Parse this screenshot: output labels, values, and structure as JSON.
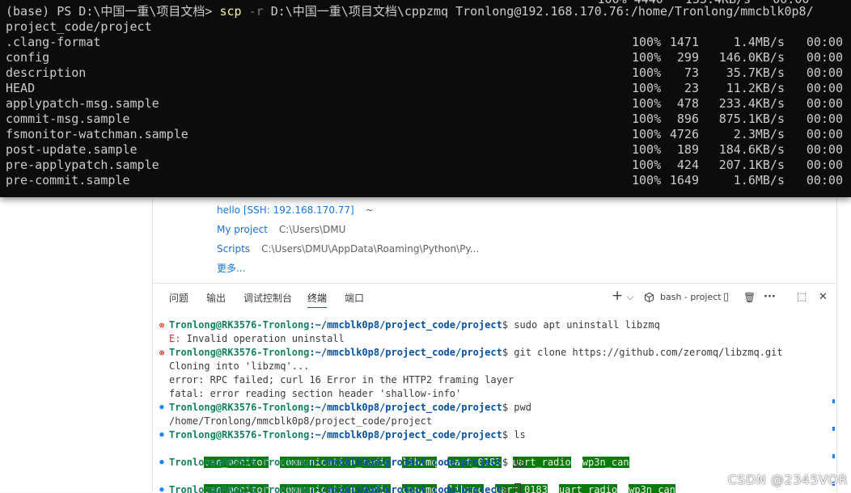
{
  "powershell": {
    "partial_top_line": "                                                                                 100% 4440   133.4KB/s   00:00",
    "prompt": "(base) PS D:\\中国一重\\项目文档> ",
    "command_verb": "scp",
    "command_flag": " -r ",
    "command_args": "D:\\中国一重\\项目文档\\cppzmq Tronlong@192.168.170.76:/home/Tronlong/mmcblk0p8/",
    "command_continuation": "project_code/project",
    "transfers": [
      {
        "name": ".clang-format",
        "pct": "100%",
        "size": "1471",
        "rate": "1.4MB/s",
        "time": "00:00"
      },
      {
        "name": "config",
        "pct": "100%",
        "size": "299",
        "rate": "146.0KB/s",
        "time": "00:00"
      },
      {
        "name": "description",
        "pct": "100%",
        "size": "73",
        "rate": "35.7KB/s",
        "time": "00:00"
      },
      {
        "name": "HEAD",
        "pct": "100%",
        "size": "23",
        "rate": "11.2KB/s",
        "time": "00:00"
      },
      {
        "name": "applypatch-msg.sample",
        "pct": "100%",
        "size": "478",
        "rate": "233.4KB/s",
        "time": "00:00"
      },
      {
        "name": "commit-msg.sample",
        "pct": "100%",
        "size": "896",
        "rate": "875.1KB/s",
        "time": "00:00"
      },
      {
        "name": "fsmonitor-watchman.sample",
        "pct": "100%",
        "size": "4726",
        "rate": "2.3MB/s",
        "time": "00:00"
      },
      {
        "name": "post-update.sample",
        "pct": "100%",
        "size": "189",
        "rate": "184.6KB/s",
        "time": "00:00"
      },
      {
        "name": "pre-applypatch.sample",
        "pct": "100%",
        "size": "424",
        "rate": "207.1KB/s",
        "time": "00:00"
      },
      {
        "name": "pre-commit.sample",
        "pct": "100%",
        "size": "1649",
        "rate": "1.6MB/s",
        "time": "00:00"
      }
    ]
  },
  "recent": {
    "items": [
      {
        "name": "hello [SSH: 192.168.170.77]",
        "path": "~"
      },
      {
        "name": "My project",
        "path": "C:\\Users\\DMU"
      },
      {
        "name": "Scripts",
        "path": "C:\\Users\\DMU\\AppData\\Roaming\\Python\\Py..."
      }
    ],
    "more": "更多..."
  },
  "panel": {
    "tabs": [
      "问题",
      "输出",
      "调试控制台",
      "终端",
      "端口"
    ],
    "active_tab": "终端",
    "new_terminal_icon": "+",
    "dropdown_icon": "⌵",
    "terminal_name": "bash - project",
    "split_icon": "▯",
    "trash_icon": "🗑",
    "more_icon": "···",
    "maximize_icon": "⬚",
    "close_icon": "✕"
  },
  "bash": {
    "user_host": "Tronlong@RK3576-Tronlong",
    "cwd": ":~/mmcblk0p8/project_code/project",
    "prompt_end": "$ ",
    "cmd1": "sudo apt uninstall libzmq",
    "cmd1_err_prefix": "E:",
    "cmd1_err_text": " Invalid operation uninstall",
    "cmd2": "git clone https://github.com/zeromq/libzmq.git",
    "cmd2_out": [
      "Cloning into 'libzmq'...",
      "error: RPC failed; curl 16 Error in the HTTP2 framing layer",
      "fatal: error reading section header 'shallow-info'"
    ],
    "cmd3": "pwd",
    "cmd3_out": "/home/Tronlong/mmcblk0p8/project_code/project",
    "cmd4": "ls",
    "ls1": [
      "can_monitor",
      "communication_radio",
      "libzmq",
      "uart_0183",
      "uart_radio",
      "wp3n_can"
    ],
    "cmd5": "ls",
    "ls2": [
      "can_monitor",
      "communication_radio",
      "cppzmq",
      "libzmq",
      "uart_0183",
      "uart_radio",
      "wp3n_can"
    ]
  },
  "watermark": "CSDN @2345VOR"
}
